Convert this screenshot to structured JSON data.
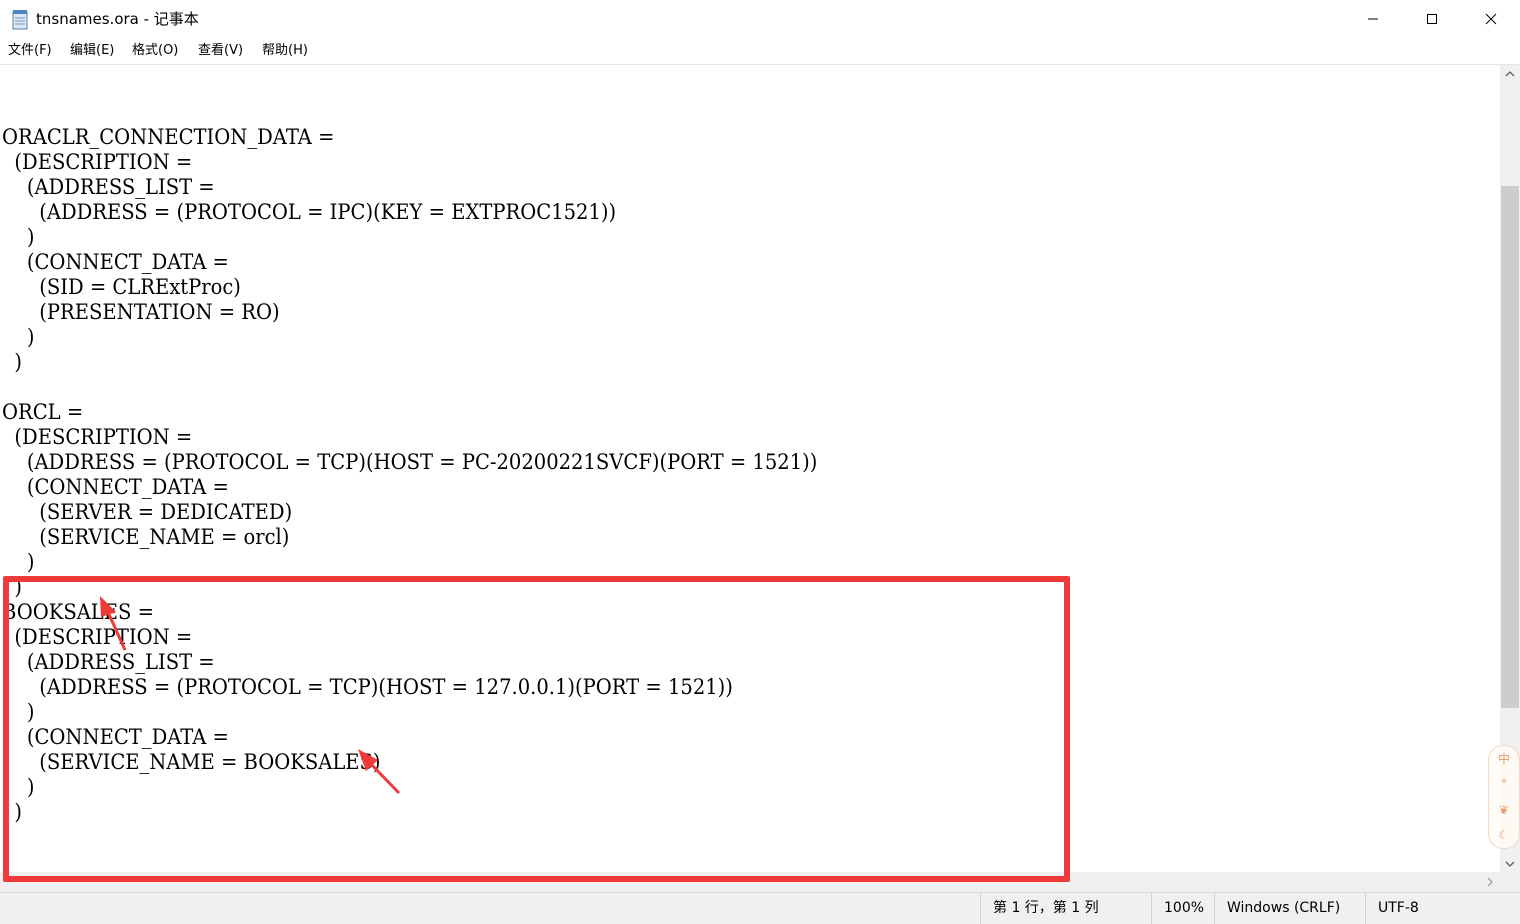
{
  "window": {
    "title": "tnsnames.ora - 记事本",
    "icon": "notepad-icon"
  },
  "menu": [
    {
      "label": "文件(F)"
    },
    {
      "label": "编辑(E)"
    },
    {
      "label": "格式(O)"
    },
    {
      "label": "查看(V)"
    },
    {
      "label": "帮助(H)"
    }
  ],
  "lines": [
    "",
    "",
    "ORACLR_CONNECTION_DATA =",
    "  (DESCRIPTION =",
    "    (ADDRESS_LIST =",
    "      (ADDRESS = (PROTOCOL = IPC)(KEY = EXTPROC1521))",
    "    )",
    "    (CONNECT_DATA =",
    "      (SID = CLRExtProc)",
    "      (PRESENTATION = RO)",
    "    )",
    "  )",
    "",
    "ORCL =",
    "  (DESCRIPTION =",
    "    (ADDRESS = (PROTOCOL = TCP)(HOST = PC-20200221SVCF)(PORT = 1521))",
    "    (CONNECT_DATA =",
    "      (SERVER = DEDICATED)",
    "      (SERVICE_NAME = orcl)",
    "    )",
    "  )",
    "BOOKSALES =",
    "  (DESCRIPTION =",
    "    (ADDRESS_LIST =",
    "      (ADDRESS = (PROTOCOL = TCP)(HOST = 127.0.0.1)(PORT = 1521))",
    "    )",
    "    (CONNECT_DATA =",
    "      (SERVICE_NAME = BOOKSALES)",
    "    )",
    "  )"
  ],
  "status": {
    "position": "第 1 行，第 1 列",
    "zoom": "100%",
    "line_ending": "Windows (CRLF)",
    "encoding": "UTF-8"
  },
  "ime": {
    "labels": [
      "中",
      "°",
      "❦",
      "☾"
    ]
  },
  "colors": {
    "annotation": "#f03a3a",
    "ime_accent": "#e89c67"
  }
}
